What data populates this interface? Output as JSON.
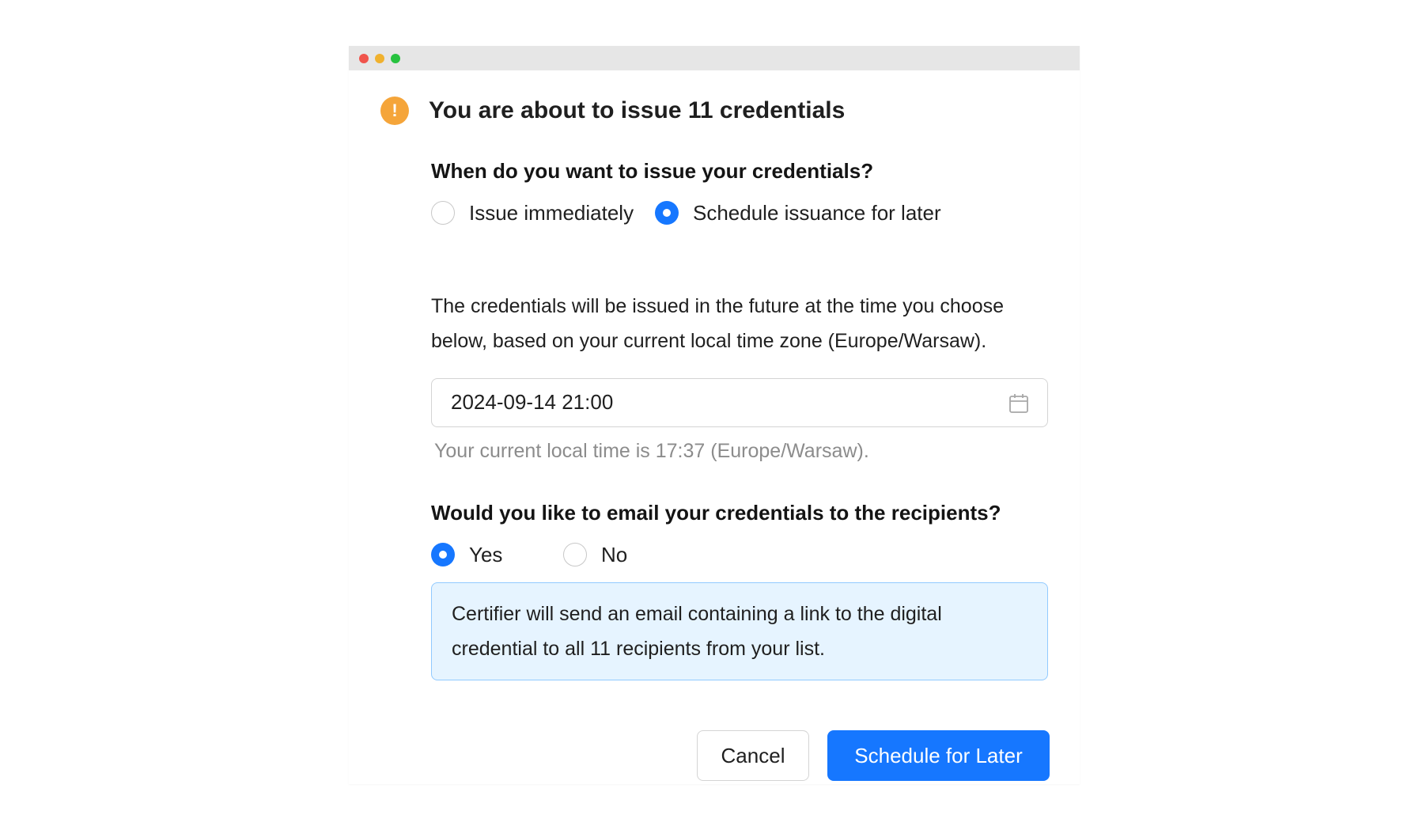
{
  "window": {
    "controls": [
      "close",
      "minimize",
      "maximize"
    ]
  },
  "dialog": {
    "icon": "warning-icon",
    "title": "You are about to issue 11 credentials"
  },
  "issuance": {
    "question": "When do you want to issue your credentials?",
    "options": [
      {
        "label": "Issue immediately",
        "checked": false
      },
      {
        "label": "Schedule issuance for later",
        "checked": true
      }
    ],
    "description": "The credentials will be issued in the future at the time you choose below, based on your current local time zone (Europe/Warsaw).",
    "datetime_value": "2024-09-14 21:00",
    "calendar_icon": "calendar-icon",
    "local_time_hint": "Your current local time is 17:37 (Europe/Warsaw)."
  },
  "email": {
    "question": "Would you like to email your credentials to the recipients?",
    "options": [
      {
        "label": "Yes",
        "checked": true
      },
      {
        "label": "No",
        "checked": false
      }
    ],
    "info": "Certifier will send an email containing a link to the digital credential to all 11 recipients from your list."
  },
  "actions": {
    "cancel_label": "Cancel",
    "primary_label": "Schedule for Later"
  },
  "colors": {
    "accent": "#1677ff",
    "warning": "#f5a53a",
    "info_bg": "#e6f4ff",
    "info_border": "#91caff",
    "hint_text": "#8c8c8c"
  }
}
